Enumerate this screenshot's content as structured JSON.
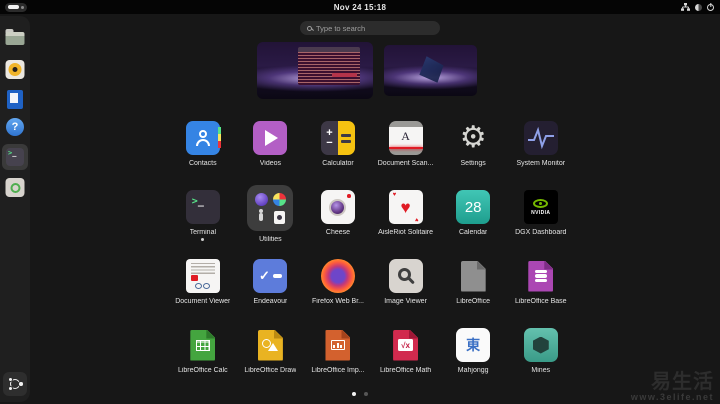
{
  "topbar": {
    "clock": "Nov 24 15:18",
    "status_icons": [
      "network-icon",
      "half-circle-icon",
      "power-icon"
    ],
    "workspace_indicator": {
      "workspaces": 2,
      "active": 1
    }
  },
  "search": {
    "placeholder": "Type to search"
  },
  "dock": {
    "icons": [
      "files-icon",
      "speaker-icon",
      "writer-document-icon",
      "help-icon",
      "terminal-icon",
      "software-icon"
    ],
    "show_apps": "show-apps-ubuntu-icon",
    "focused_item": "terminal"
  },
  "workspaces": {
    "count": 2,
    "active": 1,
    "active_has_window": "terminal window on purple wallpaper"
  },
  "apps": [
    {
      "label": "Contacts",
      "icon": "contacts-icon"
    },
    {
      "label": "Videos",
      "icon": "videos-icon"
    },
    {
      "label": "Calculator",
      "icon": "calculator-icon"
    },
    {
      "label": "Document Scan...",
      "icon": "document-scanner-icon"
    },
    {
      "label": "Settings",
      "icon": "settings-gear-icon"
    },
    {
      "label": "System Monitor",
      "icon": "system-monitor-icon"
    },
    {
      "label": "Terminal",
      "icon": "terminal-icon",
      "running": true
    },
    {
      "label": "Utilities",
      "icon": "utilities-folder-icon"
    },
    {
      "label": "Cheese",
      "icon": "cheese-camera-icon"
    },
    {
      "label": "AisleRiot Solitaire",
      "icon": "aisleriot-card-icon"
    },
    {
      "label": "Calendar",
      "icon": "calendar-icon"
    },
    {
      "label": "DGX Dashboard",
      "icon": "nvidia-icon"
    },
    {
      "label": "Document Viewer",
      "icon": "document-viewer-icon"
    },
    {
      "label": "Endeavour",
      "icon": "endeavour-check-icon"
    },
    {
      "label": "Firefox Web Br...",
      "icon": "firefox-icon"
    },
    {
      "label": "Image Viewer",
      "icon": "image-viewer-icon"
    },
    {
      "label": "LibreOffice",
      "icon": "libreoffice-icon"
    },
    {
      "label": "LibreOffice Base",
      "icon": "libreoffice-base-icon"
    },
    {
      "label": "LibreOffice Calc",
      "icon": "libreoffice-calc-icon"
    },
    {
      "label": "LibreOffice Draw",
      "icon": "libreoffice-draw-icon"
    },
    {
      "label": "LibreOffice Imp...",
      "icon": "libreoffice-impress-icon"
    },
    {
      "label": "LibreOffice Math",
      "icon": "libreoffice-math-icon"
    },
    {
      "label": "Mahjongg",
      "icon": "mahjongg-tile-icon"
    },
    {
      "label": "Mines",
      "icon": "mines-icon"
    }
  ],
  "glyphs": {
    "calculator_plus": "+",
    "calculator_minus": "−",
    "scanner_letter": "A",
    "settings_gear": "⚙",
    "prompt_gt": ">",
    "prompt_underscore": "_",
    "help_mark": "?",
    "aisleriot_suit": "♥",
    "calendar_day": "28",
    "nvidia_text": "NVIDIA",
    "endeavour_check": "✓",
    "math_formula": "√x",
    "mahjongg_tile": "東"
  },
  "pagination": {
    "pages": 2,
    "active_page": 1
  },
  "watermark": {
    "logo_text": "易生活",
    "url": "www.3elife.net"
  },
  "colors": {
    "background": "#171717",
    "topbar": "#050505",
    "accent_blue": "#3584e4",
    "nvidia_green": "#76b900",
    "calendar_teal": "#2eb3a2"
  }
}
